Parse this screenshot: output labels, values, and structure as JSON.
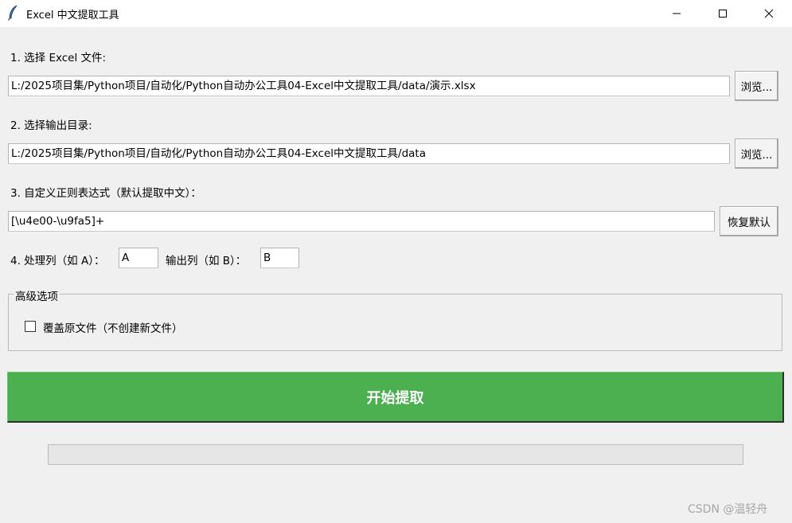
{
  "window": {
    "title": "Excel 中文提取工具",
    "icon": "feather-icon"
  },
  "excel_file": {
    "label": "1. 选择 Excel 文件:",
    "value": "L:/2025项目集/Python项目/自动化/Python自动办公工具04-Excel中文提取工具/data/演示.xlsx",
    "browse_label": "浏览..."
  },
  "output_dir": {
    "label": "2. 选择输出目录:",
    "value": "L:/2025项目集/Python项目/自动化/Python自动办公工具04-Excel中文提取工具/data",
    "browse_label": "浏览..."
  },
  "regex": {
    "label": "3. 自定义正则表达式（默认提取中文）：",
    "value": "[\\u4e00-\\u9fa5]+",
    "restore_label": "恢复默认"
  },
  "columns": {
    "process_label": "4. 处理列（如 A）：",
    "process_value": "A",
    "output_label": "输出列（如 B）：",
    "output_value": "B"
  },
  "advanced": {
    "title": "高级选项",
    "overwrite_label": "覆盖原文件（不创建新文件）",
    "overwrite_checked": false
  },
  "start_button": {
    "label": "开始提取",
    "color": "#4caf50"
  },
  "progress": {
    "value": 0
  },
  "watermark": "CSDN @温轻舟"
}
